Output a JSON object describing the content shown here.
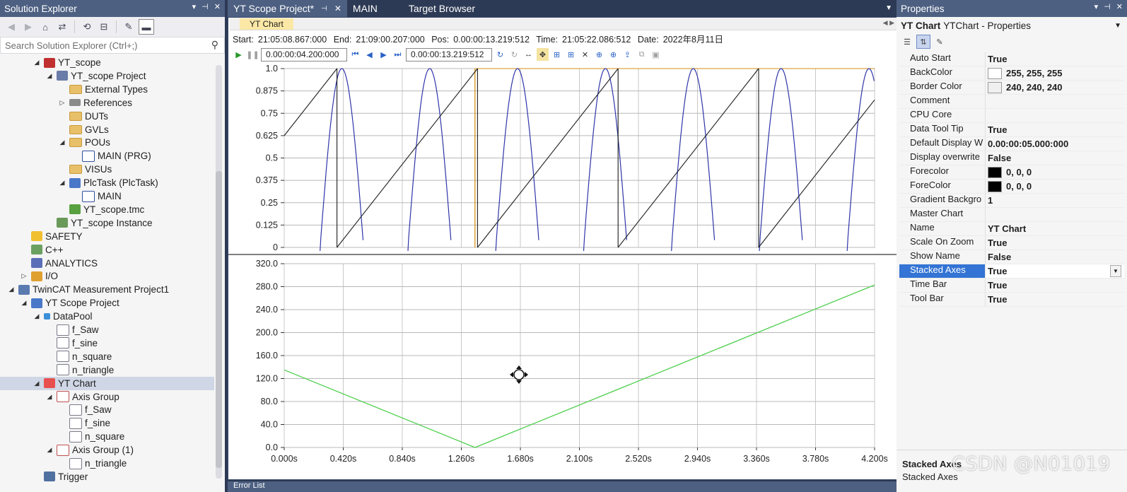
{
  "solution_explorer": {
    "title": "Solution Explorer",
    "search_placeholder": "Search Solution Explorer (Ctrl+;)",
    "items": [
      {
        "label": "YT_scope",
        "level": 3,
        "expand": "open",
        "icon": "plc-project-icon"
      },
      {
        "label": "YT_scope Project",
        "level": 4,
        "expand": "open",
        "icon": "plc-icon"
      },
      {
        "label": "External Types",
        "level": 5,
        "expand": "",
        "icon": "folder-icon"
      },
      {
        "label": "References",
        "level": 5,
        "expand": "closed",
        "icon": "references-icon"
      },
      {
        "label": "DUTs",
        "level": 5,
        "expand": "",
        "icon": "folder-icon"
      },
      {
        "label": "GVLs",
        "level": 5,
        "expand": "",
        "icon": "folder-icon"
      },
      {
        "label": "POUs",
        "level": 5,
        "expand": "open",
        "icon": "folder-icon"
      },
      {
        "label": "MAIN (PRG)",
        "level": 6,
        "expand": "",
        "icon": "pou-icon"
      },
      {
        "label": "VISUs",
        "level": 5,
        "expand": "",
        "icon": "folder-icon"
      },
      {
        "label": "PlcTask (PlcTask)",
        "level": 5,
        "expand": "open",
        "icon": "task-icon"
      },
      {
        "label": "MAIN",
        "level": 6,
        "expand": "",
        "icon": "pou-icon"
      },
      {
        "label": "YT_scope.tmc",
        "level": 5,
        "expand": "",
        "icon": "tmc-icon"
      },
      {
        "label": "YT_scope Instance",
        "level": 4,
        "expand": "",
        "icon": "instance-icon"
      },
      {
        "label": "SAFETY",
        "level": 2,
        "expand": "",
        "icon": "safety-icon"
      },
      {
        "label": "C++",
        "level": 2,
        "expand": "",
        "icon": "cpp-icon"
      },
      {
        "label": "ANALYTICS",
        "level": 2,
        "expand": "",
        "icon": "analytics-icon"
      },
      {
        "label": "I/O",
        "level": 2,
        "expand": "closed",
        "icon": "io-icon"
      },
      {
        "label": "TwinCAT Measurement Project1",
        "level": 1,
        "expand": "open",
        "icon": "measurement-icon"
      },
      {
        "label": "YT Scope Project",
        "level": 2,
        "expand": "open",
        "icon": "scope-project-icon"
      },
      {
        "label": "DataPool",
        "level": 3,
        "expand": "open",
        "icon": "datapool-icon"
      },
      {
        "label": "f_Saw",
        "level": 4,
        "expand": "",
        "icon": "var-lreal-icon"
      },
      {
        "label": "f_sine",
        "level": 4,
        "expand": "",
        "icon": "var-lreal-icon"
      },
      {
        "label": "n_square",
        "level": 4,
        "expand": "",
        "icon": "var-int-icon"
      },
      {
        "label": "n_triangle",
        "level": 4,
        "expand": "",
        "icon": "var-int-icon"
      },
      {
        "label": "YT Chart",
        "level": 3,
        "expand": "open",
        "icon": "chart-icon",
        "selected": true
      },
      {
        "label": "Axis Group",
        "level": 4,
        "expand": "open",
        "icon": "axis-group-icon"
      },
      {
        "label": "f_Saw",
        "level": 5,
        "expand": "",
        "icon": "channel-icon"
      },
      {
        "label": "f_sine",
        "level": 5,
        "expand": "",
        "icon": "channel-icon"
      },
      {
        "label": "n_square",
        "level": 5,
        "expand": "",
        "icon": "channel-icon"
      },
      {
        "label": "Axis Group (1)",
        "level": 4,
        "expand": "open",
        "icon": "axis-group-icon"
      },
      {
        "label": "n_triangle",
        "level": 5,
        "expand": "",
        "icon": "channel-icon"
      },
      {
        "label": "Trigger",
        "level": 3,
        "expand": "",
        "icon": "trigger-icon"
      }
    ]
  },
  "tabs": [
    {
      "label": "YT Scope Project*",
      "active": true
    },
    {
      "label": "MAIN",
      "active": false
    },
    {
      "label": "Target Browser",
      "active": false
    }
  ],
  "chart_tab": "YT Chart",
  "info": {
    "start_label": "Start:",
    "start": "21:05:08.867:000",
    "end_label": "End:",
    "end": "21:09:00.207:000",
    "pos_label": "Pos:",
    "pos": "0.00:00:13.219:512",
    "time_label": "Time:",
    "time": "21:05:22.086:512",
    "date_label": "Date:",
    "date": "2022年8月11日"
  },
  "controls": {
    "range_field": "0.00:00:04.200:000",
    "pos_field": "0.00:00:13.219:512"
  },
  "chart_data": [
    {
      "type": "line",
      "name": "top-axis-group",
      "ylim": [
        0,
        1.0
      ],
      "yticks": [
        "1.0",
        "0.875",
        "0.75",
        "0.625",
        "0.5",
        "0.375",
        "0.25",
        "0.125",
        "0"
      ],
      "xlim": [
        0,
        4.2
      ],
      "series": [
        {
          "color": "#1c1c1c",
          "kind": "saw",
          "period": 1.0,
          "start_value": 0.625
        },
        {
          "color": "#2f35a8",
          "kind": "sine-lobes",
          "period": 0.625,
          "first_peak": 0.41
        },
        {
          "color": "#d4921a",
          "kind": "square",
          "edge": 1.357
        }
      ]
    },
    {
      "type": "line",
      "name": "bottom-axis-group",
      "ylim": [
        0,
        320
      ],
      "yticks": [
        "320.0",
        "280.0",
        "240.0",
        "200.0",
        "160.0",
        "120.0",
        "80.0",
        "40.0",
        "0.0"
      ],
      "xticks": [
        "0.000s",
        "0.420s",
        "0.840s",
        "1.260s",
        "1.680s",
        "2.100s",
        "2.520s",
        "2.940s",
        "3.360s",
        "3.780s",
        "4.200s"
      ],
      "xlim": [
        0,
        4.2
      ],
      "series": [
        {
          "color": "#4fcf4f",
          "x": [
            0,
            1.357,
            4.2
          ],
          "y": [
            135,
            0,
            283
          ]
        }
      ]
    }
  ],
  "properties": {
    "title": "Properties",
    "object": "YT Chart",
    "object_type": "YTChart - Properties",
    "rows": [
      {
        "name": "Auto Start",
        "value": "True"
      },
      {
        "name": "BackColor",
        "value": "255, 255, 255",
        "swatch": "#ffffff"
      },
      {
        "name": "Border Color",
        "value": "240, 240, 240",
        "swatch": "#f0f0f0"
      },
      {
        "name": "Comment",
        "value": ""
      },
      {
        "name": "CPU Core",
        "value": ""
      },
      {
        "name": "Data Tool Tip",
        "value": "True"
      },
      {
        "name": "Default Display W",
        "value": "0.00:00:05.000:000"
      },
      {
        "name": "Display overwrite",
        "value": "False"
      },
      {
        "name": "Forecolor",
        "value": "0, 0, 0",
        "swatch": "#000000"
      },
      {
        "name": "ForeColor",
        "value": "0, 0, 0",
        "swatch": "#000000"
      },
      {
        "name": "Gradient Backgro",
        "value": "1"
      },
      {
        "name": "Master Chart",
        "value": ""
      },
      {
        "name": "Name",
        "value": "YT Chart"
      },
      {
        "name": "Scale On Zoom",
        "value": "True"
      },
      {
        "name": "Show Name",
        "value": "False"
      },
      {
        "name": "Stacked Axes",
        "value": "True",
        "selected": true
      },
      {
        "name": "Time Bar",
        "value": "True"
      },
      {
        "name": "Tool Bar",
        "value": "True"
      }
    ],
    "desc_title": "Stacked Axes",
    "desc_text": "Stacked Axes"
  },
  "watermark": "CSDN @N01019",
  "error_list": "Error List"
}
